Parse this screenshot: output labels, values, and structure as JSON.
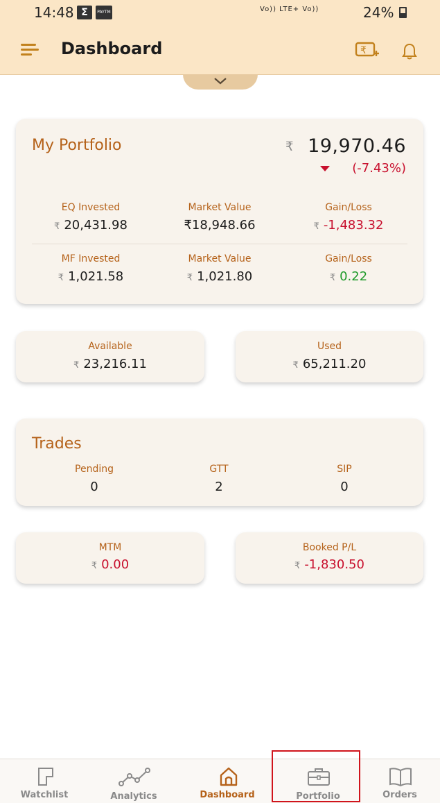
{
  "status_bar": {
    "time": "14:48",
    "e_badge": "Σ",
    "paytm_badge": "PAYTM",
    "network": "Vo)) LTE+ Vo)) ",
    "battery": "24%"
  },
  "header": {
    "title": "Dashboard"
  },
  "portfolio": {
    "title": "My Portfolio",
    "currency": "₹",
    "total_value": "19,970.46",
    "change": "(-7.43%)",
    "rows": [
      {
        "invested_label": "EQ Invested",
        "invested_value": "20,431.98",
        "market_label": "Market Value",
        "market_value": "₹18,948.66",
        "gain_label": "Gain/Loss",
        "gain_value": "-1,483.32"
      },
      {
        "invested_label": "MF Invested",
        "invested_value": "1,021.58",
        "market_label": "Market Value",
        "market_value": "1,021.80",
        "gain_label": "Gain/Loss",
        "gain_value": "0.22"
      }
    ]
  },
  "funds": {
    "available_label": "Available",
    "available_value": "23,216.11",
    "used_label": "Used",
    "used_value": "65,211.20"
  },
  "trades": {
    "title": "Trades",
    "pending_label": "Pending",
    "pending_value": "0",
    "gtt_label": "GTT",
    "gtt_value": "2",
    "sip_label": "SIP",
    "sip_value": "0"
  },
  "pnl": {
    "mtm_label": "MTM",
    "mtm_value": "0.00",
    "booked_label": "Booked P/L",
    "booked_value": "-1,830.50"
  },
  "bottom_nav": {
    "items": [
      {
        "label": "Watchlist",
        "icon": "bookmark-icon"
      },
      {
        "label": "Analytics",
        "icon": "trend-line-icon"
      },
      {
        "label": "Dashboard",
        "icon": "home-icon"
      },
      {
        "label": "Portfolio",
        "icon": "briefcase-icon"
      },
      {
        "label": "Orders",
        "icon": "book-icon"
      }
    ],
    "active": "Dashboard"
  },
  "colors": {
    "header_bg": "#fbe6c6",
    "accent": "#b5621a",
    "negative": "#c8102e",
    "positive": "#1f9a2a",
    "card_bg": "#f8f3ec",
    "highlight": "#d0141c"
  }
}
